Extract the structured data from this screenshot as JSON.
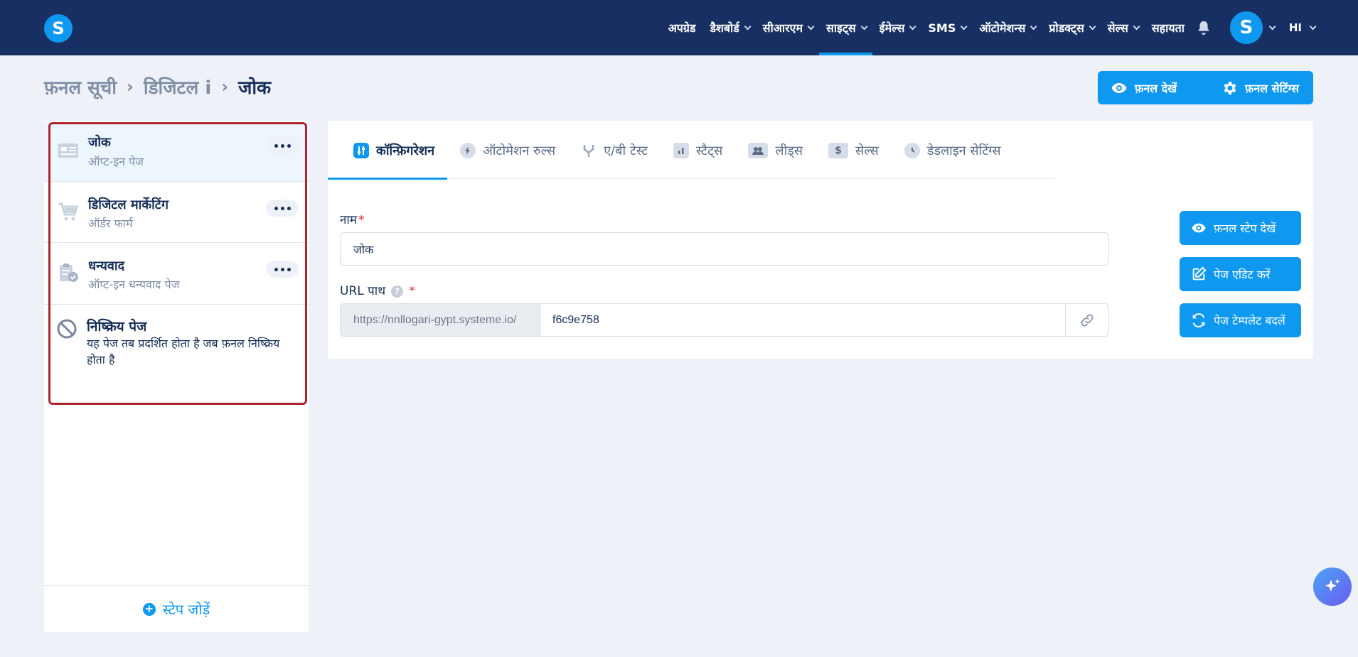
{
  "nav": {
    "items": [
      {
        "label": "अपग्रेड"
      },
      {
        "label": "डैशबोर्ड"
      },
      {
        "label": "सीआरएम"
      },
      {
        "label": "साइट्स"
      },
      {
        "label": "ईमेल्स"
      },
      {
        "label": "SMS"
      },
      {
        "label": "ऑटोमेशन्स"
      },
      {
        "label": "प्रोडक्ट्स"
      },
      {
        "label": "सेल्स"
      },
      {
        "label": "सहायता"
      }
    ],
    "active": "साइट्स",
    "avatar_letter": "S",
    "language": "HI",
    "logo_letter": "S"
  },
  "breadcrumb": {
    "items": [
      "फ़नल सूची",
      "डिजिटल i",
      "जोक"
    ]
  },
  "header_buttons": {
    "view_funnel": "फ़नल देखें",
    "funnel_settings": "फ़नल सेटिंग्स"
  },
  "steps": [
    {
      "title": "जोक",
      "subtitle": "ऑप्ट-इन पेज",
      "icon": "optin-page-icon",
      "active": true
    },
    {
      "title": "डिजिटल मार्केटिंग",
      "subtitle": "ऑर्डर फार्म",
      "icon": "cart-icon",
      "active": false
    },
    {
      "title": "धन्यवाद",
      "subtitle": "ऑप्ट-इन धन्यवाद पेज",
      "icon": "clipboard-check-icon",
      "active": false
    }
  ],
  "inactive_page": {
    "title": "निष्क्रिय पेज",
    "description": "यह पेज तब प्रदर्शित होता है जब फ़नल निष्क्रिय होता है"
  },
  "add_step_label": "स्टेप जोड़ें",
  "tabs": [
    {
      "label": "कॉन्फ़िगरेशन",
      "icon": "sliders-icon",
      "active": true
    },
    {
      "label": "ऑटोमेशन रुल्स",
      "icon": "bolt-icon",
      "active": false
    },
    {
      "label": "ए/बी टेस्ट",
      "icon": "split-icon",
      "active": false
    },
    {
      "label": "स्टैट्स",
      "icon": "bar-chart-icon",
      "active": false
    },
    {
      "label": "लीड्स",
      "icon": "users-icon",
      "active": false
    },
    {
      "label": "सेल्स",
      "icon": "dollar-icon",
      "active": false
    },
    {
      "label": "डेडलाइन सेटिंग्स",
      "icon": "clock-icon",
      "active": false
    }
  ],
  "form": {
    "name_label": "नाम",
    "name_value": "जोक",
    "url_label": "URL पाथ",
    "url_prefix": "https://nnllogari-gypt.systeme.io/",
    "url_value": "f6c9e758",
    "required_mark": "*",
    "help_mark": "?"
  },
  "side_buttons": {
    "view_step": "फ़नल स्टेप देखें",
    "edit_page": "पेज एडिट करें",
    "change_template": "पेज टेम्पलेट बदलें"
  },
  "colors": {
    "nav_bg": "#172f63",
    "accent": "#0f98ef",
    "highlight_border": "#b1262e",
    "page_bg": "#eef2f8"
  }
}
